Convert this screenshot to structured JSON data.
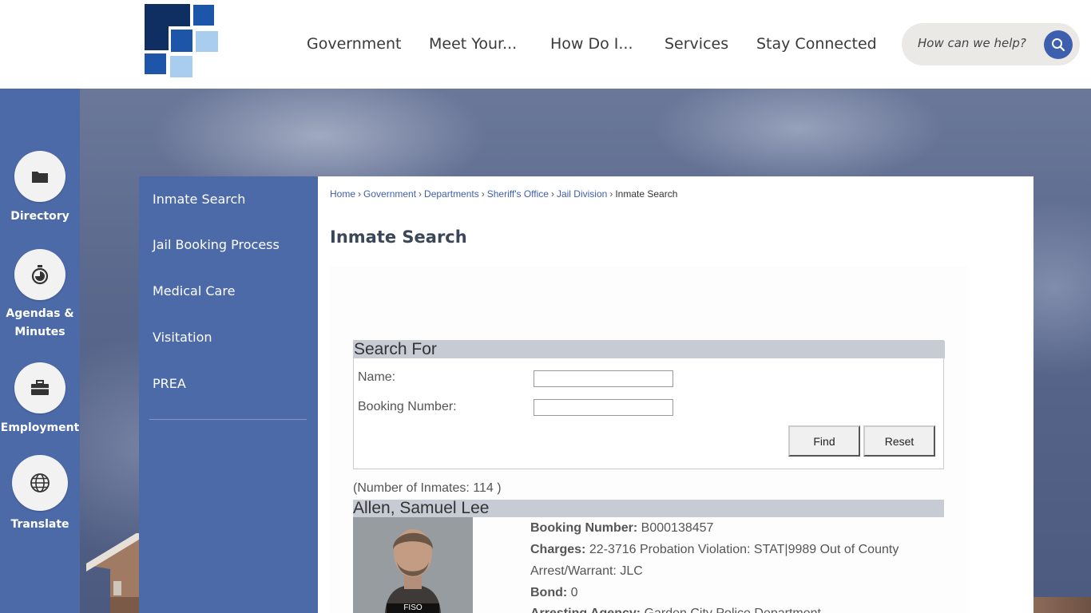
{
  "nav": {
    "items": [
      "Government",
      "Meet Your...",
      "How Do I...",
      "Services",
      "Stay Connected"
    ]
  },
  "search": {
    "placeholder": "How can we help?"
  },
  "quick_links": [
    {
      "label": "Directory",
      "icon": "folder-icon"
    },
    {
      "label": "Agendas & Minutes",
      "label_lines": [
        "Agendas &",
        "Minutes"
      ],
      "icon": "stopwatch-icon"
    },
    {
      "label": "Employment",
      "icon": "briefcase-icon"
    },
    {
      "label": "Translate",
      "icon": "globe-icon"
    }
  ],
  "sidenav": {
    "items": [
      "Inmate Search",
      "Jail Booking Process",
      "Medical Care",
      "Visitation",
      "PREA"
    ]
  },
  "breadcrumb": {
    "links": [
      "Home",
      "Government",
      "Departments",
      "Sheriff's Office",
      "Jail Division"
    ],
    "current": "Inmate Search"
  },
  "page_title": "Inmate Search",
  "search_panel": {
    "heading": "Search For",
    "name_label": "Name:",
    "name_value": "",
    "booking_label": "Booking Number:",
    "booking_value": "",
    "find_label": "Find",
    "reset_label": "Reset"
  },
  "inmate_count": "(Number of Inmates: 114 )",
  "record": {
    "name": "Allen, Samuel Lee",
    "photo_caption": "FISO",
    "booking_number_label": "Booking Number:",
    "booking_number": "B000138457",
    "charges_label": "Charges:",
    "charges_line1": "22-3716 Probation Violation: STAT|9989 Out of County",
    "charges_line2": "Arrest/Warrant: JLC",
    "bond_label": "Bond:",
    "bond": "0",
    "agency_label": "Arresting Agency:",
    "agency": "Garden City Police Department"
  },
  "colors": {
    "brand_blue": "#4c6aa8",
    "link_blue": "#3e5fad",
    "panel_header": "#c6cbd4"
  }
}
